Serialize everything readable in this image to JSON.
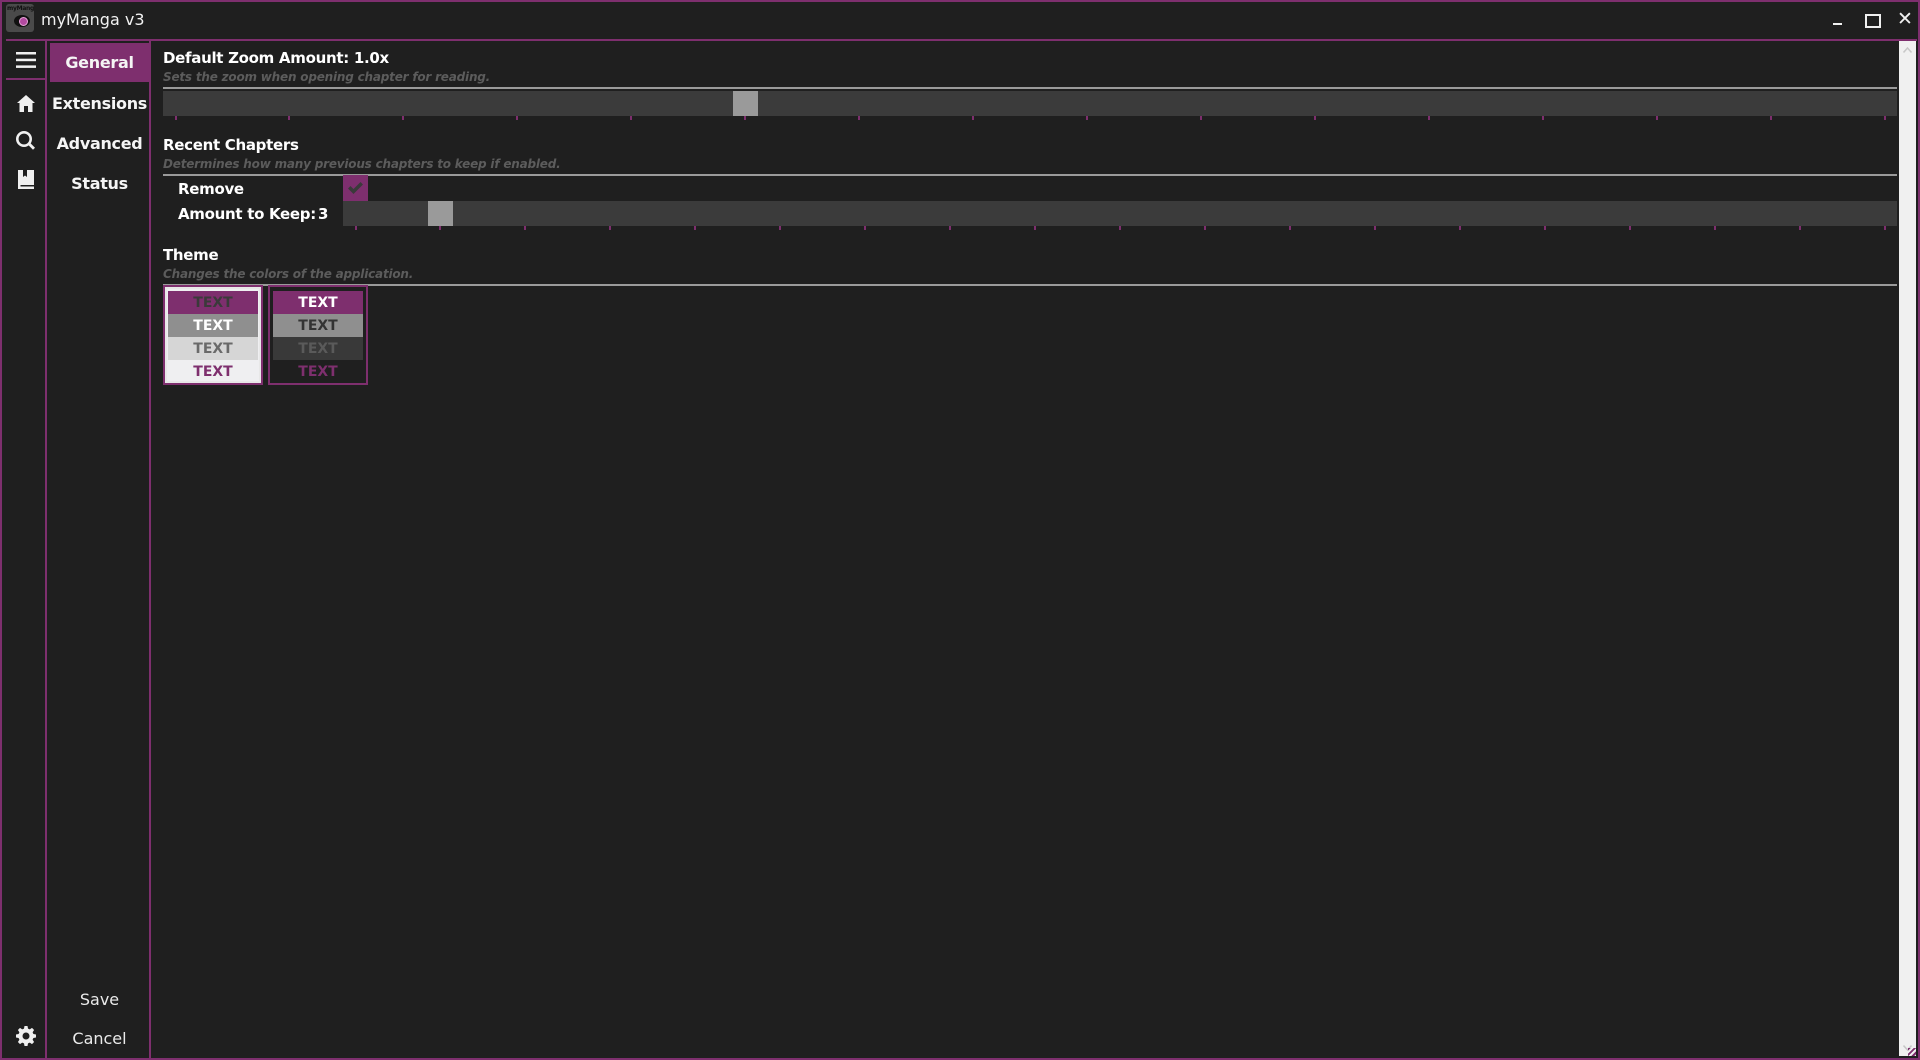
{
  "window": {
    "title": "myManga v3",
    "app_icon_text": "myManga",
    "accent_color": "#7E2F6E",
    "controls": {
      "minimize": "minimize-icon",
      "maximize": "maximize-icon",
      "close": "close-icon"
    }
  },
  "rail": {
    "items": [
      {
        "name": "menu",
        "icon": "hamburger-icon"
      },
      {
        "name": "home",
        "icon": "home-icon"
      },
      {
        "name": "search",
        "icon": "search-icon"
      },
      {
        "name": "library",
        "icon": "book-icon"
      },
      {
        "name": "settings",
        "icon": "gear-icon"
      }
    ]
  },
  "nav": {
    "items": [
      {
        "label": "General",
        "active": true
      },
      {
        "label": "Extensions",
        "active": false
      },
      {
        "label": "Advanced",
        "active": false
      },
      {
        "label": "Status",
        "active": false
      }
    ],
    "save_label": "Save",
    "cancel_label": "Cancel"
  },
  "settings": {
    "zoom": {
      "title": "Default Zoom Amount: 1.0x",
      "description": "Sets the zoom when opening chapter for reading.",
      "value": 1.0,
      "min": 0.5,
      "max": 2.0,
      "step": 0.1
    },
    "recent": {
      "title": "Recent Chapters",
      "description": "Determines how many previous chapters to keep if enabled.",
      "remove_label": "Remove",
      "remove_checked": true,
      "amount_label": "Amount to Keep:",
      "amount_value": "3",
      "amount": 3,
      "amount_min": 2,
      "amount_max": 20,
      "amount_step": 1
    },
    "theme": {
      "title": "Theme",
      "description": "Changes the colors of the application.",
      "options": [
        {
          "name": "light",
          "selected": true,
          "rows": [
            "TEXT",
            "TEXT",
            "TEXT",
            "TEXT"
          ]
        },
        {
          "name": "dark",
          "selected": false,
          "rows": [
            "TEXT",
            "TEXT",
            "TEXT",
            "TEXT"
          ]
        }
      ]
    }
  }
}
